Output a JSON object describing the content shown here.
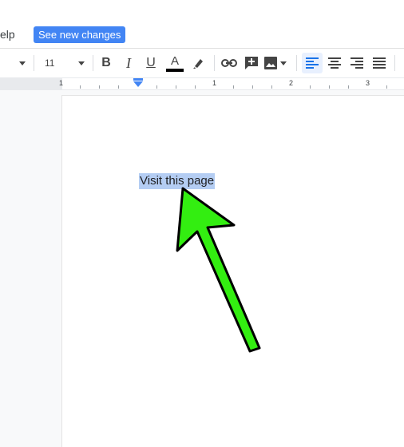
{
  "menubar": {
    "help_label": "elp",
    "see_changes_label": "See new changes"
  },
  "toolbar": {
    "font_size": "11",
    "bold_label": "B",
    "italic_label": "I",
    "underline_label": "U",
    "text_color_label": "A",
    "text_color": "#000000",
    "icons": [
      "font-dropdown-caret-icon",
      "font-size-caret-icon",
      "bold-icon",
      "italic-icon",
      "underline-icon",
      "text-color-icon",
      "highlight-pen-icon",
      "insert-link-icon",
      "add-comment-icon",
      "insert-image-icon",
      "align-left-icon",
      "align-center-icon",
      "align-right-icon",
      "justify-icon"
    ]
  },
  "ruler": {
    "labels": [
      "1",
      "1",
      "2",
      "3"
    ]
  },
  "document": {
    "selected_text": "Visit this page"
  },
  "colors": {
    "accent": "#4285f4",
    "selection": "#b4cdf3",
    "annotation_arrow": "#33ee11"
  }
}
